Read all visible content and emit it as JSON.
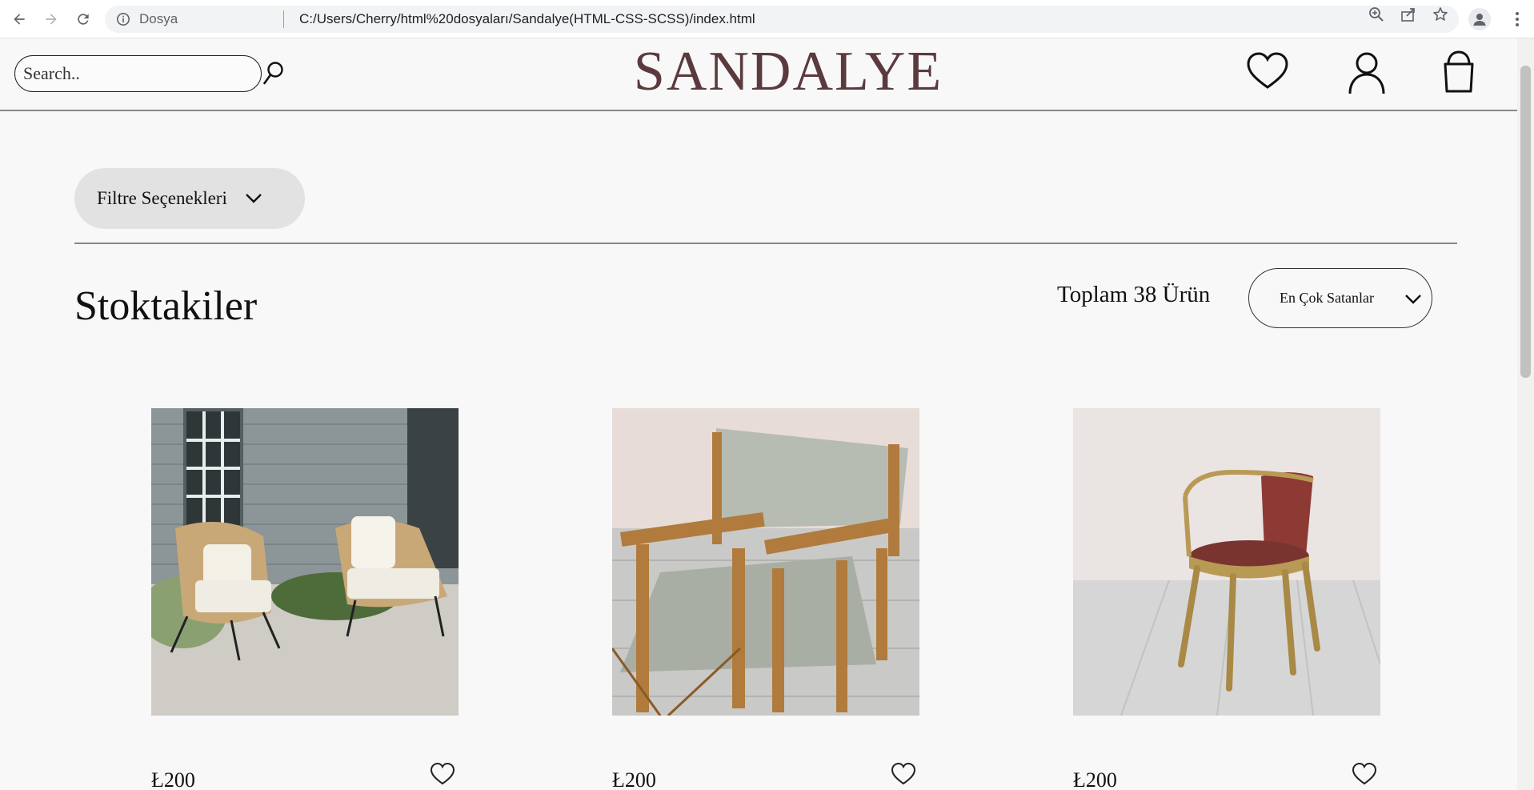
{
  "browser": {
    "scheme_label": "Dosya",
    "url": "C:/Users/Cherry/html%20dosyaları/Sandalye(HTML-CSS-SCSS)/index.html"
  },
  "header": {
    "search_placeholder": "Search..",
    "logo": "SANDALYE",
    "icons": [
      "heart-icon",
      "user-icon",
      "shopping-bag-icon"
    ]
  },
  "filters": {
    "label": "Filtre Seçenekleri"
  },
  "listing": {
    "title": "Stoktakiler",
    "total": "Toplam 38 Ürün",
    "sort_selected": "En Çok Satanlar"
  },
  "products": [
    {
      "price": "Ł200",
      "image": "rattan-outdoor-chairs"
    },
    {
      "price": "Ł200",
      "image": "director-chair"
    },
    {
      "price": "Ł200",
      "image": "metal-leather-chair"
    }
  ],
  "colors": {
    "logo": "#5b3a3e",
    "page_bg": "#f8f8f8",
    "filter_bg": "#e2e2e2"
  }
}
